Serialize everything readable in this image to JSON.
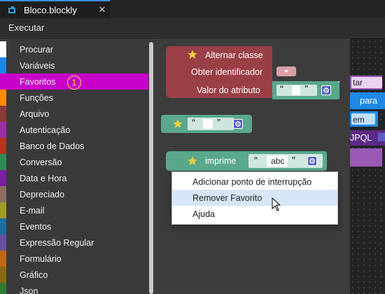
{
  "tab": {
    "title": "Bloco.blockly",
    "close_label": "✕",
    "icon": "blocks-logo-icon"
  },
  "menu": {
    "executar": "Executar"
  },
  "toolbox": {
    "items": [
      {
        "label": "Procurar",
        "color": "#ffffff"
      },
      {
        "label": "Variáveis",
        "color": "#1e88e5"
      },
      {
        "label": "Favoritos",
        "color": "#c800c8",
        "selected": true
      },
      {
        "label": "Funções",
        "color": "#ff8c00"
      },
      {
        "label": "Arquivo",
        "color": "#8b3a3a"
      },
      {
        "label": "Autenticação",
        "color": "#9c2fa6"
      },
      {
        "label": "Banco de Dados",
        "color": "#b5361a"
      },
      {
        "label": "Conversão",
        "color": "#2e8b57"
      },
      {
        "label": "Data e Hora",
        "color": "#7a1fa2"
      },
      {
        "label": "Depreciado",
        "color": "#8d6e63"
      },
      {
        "label": "E-mail",
        "color": "#9e9d24"
      },
      {
        "label": "Eventos",
        "color": "#1a6fa0"
      },
      {
        "label": "Expressão Regular",
        "color": "#6a4fa0"
      },
      {
        "label": "Formulário",
        "color": "#c26a1a"
      },
      {
        "label": "Gráfico",
        "color": "#8b6914"
      },
      {
        "label": "Json",
        "color": "#2e7d32"
      }
    ],
    "badge": "1"
  },
  "blocks": {
    "alternar_classe": "Alternar classe",
    "obter_identificador": "Obter identificador",
    "valor_do_atributo": "Valor do atributo",
    "imprime": "imprime",
    "abc": "abc",
    "quote_open": "“",
    "quote_close": "”"
  },
  "side_blocks": {
    "tar": "tar",
    "para": "para",
    "em": "em",
    "jpql": "JPQL"
  },
  "context_menu": {
    "items": [
      "Adicionar ponto de interrupção",
      "Remover Favorito",
      "Ajuda"
    ],
    "highlighted_index": 1
  },
  "colors": {
    "favorite_block": "#9a3f46",
    "string_block": "#5aa88c",
    "string_field": "#cfe6df",
    "print_block": "#5aa88c",
    "selection": "#c800c8"
  }
}
